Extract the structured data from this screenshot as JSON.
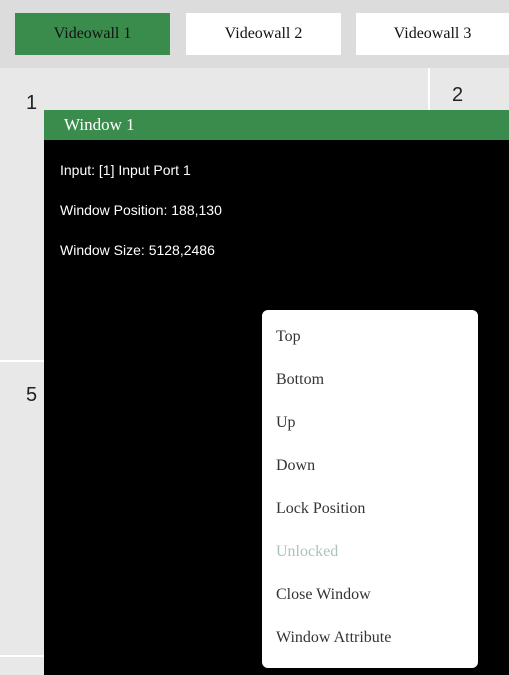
{
  "tabs": [
    {
      "label": "Videowall 1",
      "active": true
    },
    {
      "label": "Videowall 2",
      "active": false
    },
    {
      "label": "Videowall 3",
      "active": false
    }
  ],
  "cells": [
    "1",
    "2",
    "5"
  ],
  "window": {
    "title": "Window 1",
    "input": "Input: [1] Input Port 1",
    "position": "Window Position: 188,130",
    "size": "Window Size: 5128,2486"
  },
  "context_menu": {
    "items": [
      {
        "label": "Top",
        "enabled": true
      },
      {
        "label": "Bottom",
        "enabled": true
      },
      {
        "label": "Up",
        "enabled": true
      },
      {
        "label": "Down",
        "enabled": true
      },
      {
        "label": "Lock Position",
        "enabled": true
      },
      {
        "label": "Unlocked",
        "enabled": false
      },
      {
        "label": "Close Window",
        "enabled": true
      },
      {
        "label": "Window Attribute",
        "enabled": true
      }
    ]
  },
  "colors": {
    "accent": "#3a8c4d",
    "window_bg": "#000000",
    "disabled_text": "#a8c4c0"
  }
}
